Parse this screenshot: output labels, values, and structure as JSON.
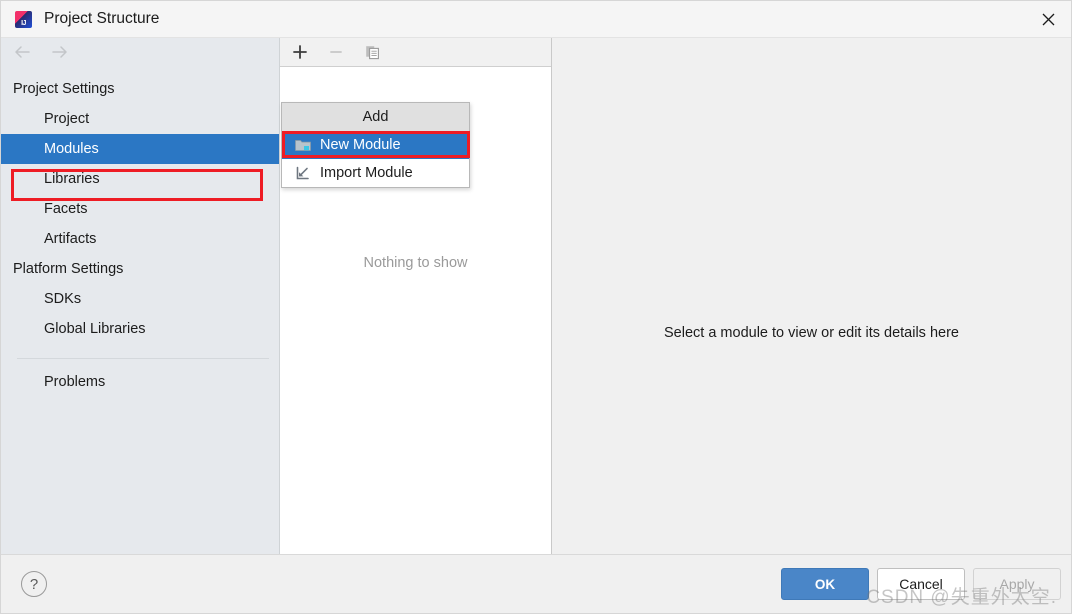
{
  "window": {
    "title": "Project Structure",
    "app_icon": "intellij-idea-icon",
    "close_label": "✕"
  },
  "sidebar": {
    "nav": {
      "back": "back-arrow",
      "forward": "forward-arrow"
    },
    "groups": [
      {
        "label": "Project Settings",
        "items": [
          {
            "label": "Project",
            "selected": false
          },
          {
            "label": "Modules",
            "selected": true
          },
          {
            "label": "Libraries",
            "selected": false
          },
          {
            "label": "Facets",
            "selected": false
          },
          {
            "label": "Artifacts",
            "selected": false
          }
        ]
      },
      {
        "label": "Platform Settings",
        "items": [
          {
            "label": "SDKs",
            "selected": false
          },
          {
            "label": "Global Libraries",
            "selected": false
          }
        ]
      }
    ],
    "problems": {
      "label": "Problems"
    }
  },
  "middle_panel": {
    "toolbar": {
      "add": "+",
      "remove": "−",
      "copy": "copy-icon"
    },
    "empty_text": "Nothing to show"
  },
  "menu": {
    "header": "Add",
    "items": [
      {
        "label": "New Module",
        "icon": "new-folder-icon",
        "highlighted": true
      },
      {
        "label": "Import Module",
        "icon": "import-arrow-icon",
        "highlighted": false
      }
    ]
  },
  "right_panel": {
    "message": "Select a module to view or edit its details here"
  },
  "footer": {
    "help": "?",
    "ok": "OK",
    "cancel": "Cancel",
    "apply": "Apply"
  },
  "watermark": {
    "text": "CSDN @失重外太空."
  },
  "colors": {
    "selection_blue": "#2b77c4",
    "annotation_red": "#ee1c24",
    "primary_button": "#4a86c8",
    "sidebar_bg": "#e6e9ed"
  }
}
